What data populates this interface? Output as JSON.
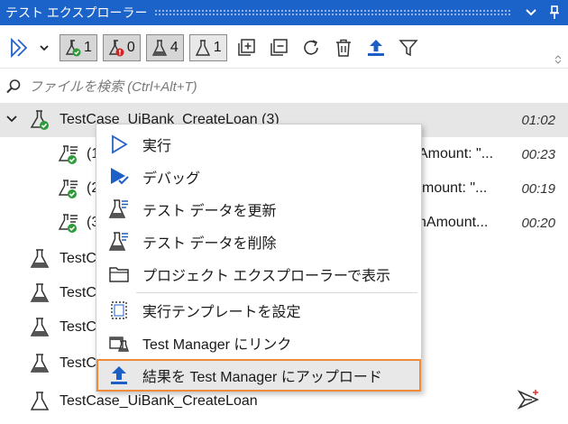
{
  "window": {
    "title": "テスト エクスプローラー",
    "accent_color": "#1b62c9",
    "pin_icon": "pin-icon",
    "dropdown_icon": "chevron-down-icon"
  },
  "toolbar": {
    "run_icon": "run-all-icon",
    "filters": [
      {
        "name": "passed",
        "count": "1",
        "icon": "flask-pass-icon"
      },
      {
        "name": "failed",
        "count": "0",
        "icon": "flask-fail-icon"
      },
      {
        "name": "total",
        "count": "4",
        "icon": "flask-icon"
      },
      {
        "name": "not-run",
        "count": "1",
        "icon": "flask-outline-icon"
      }
    ],
    "actions": [
      "expand-all-icon",
      "collapse-all-icon",
      "refresh-icon",
      "delete-icon",
      "upload-icon",
      "filter-icon"
    ]
  },
  "search": {
    "placeholder": "ファイルを検索 (Ctrl+Alt+T)"
  },
  "tree": {
    "group": {
      "label": "TestCase_UiBank_CreateLoan (3)",
      "time": "01:02"
    },
    "children": [
      {
        "prefix": "(1",
        "tail": "Amount: \"...",
        "time": "00:23"
      },
      {
        "prefix": "(2",
        "tail": "mount: \"...",
        "time": "00:19"
      },
      {
        "prefix": "(3",
        "tail": "nAmount...",
        "time": "00:20"
      }
    ],
    "items": [
      {
        "label": "TestCa"
      },
      {
        "label": "TestC"
      },
      {
        "label": "TestC"
      },
      {
        "label": "TestC"
      },
      {
        "label": "TestCase_UiBank_CreateLoan"
      }
    ]
  },
  "context_menu": {
    "items": [
      {
        "label": "実行",
        "icon": "run-icon"
      },
      {
        "label": "デバッグ",
        "icon": "debug-icon"
      },
      {
        "label": "テスト データを更新",
        "icon": "update-test-data-icon"
      },
      {
        "label": "テスト データを削除",
        "icon": "remove-test-data-icon"
      },
      {
        "label": "プロジェクト エクスプローラーで表示",
        "icon": "folder-icon"
      },
      {
        "label": "実行テンプレートを設定",
        "icon": "template-icon"
      },
      {
        "label": "Test Manager にリンク",
        "icon": "link-test-manager-icon"
      },
      {
        "label": "結果を Test Manager にアップロード",
        "icon": "upload-icon"
      }
    ],
    "highlight_color": "#f08a3c"
  }
}
